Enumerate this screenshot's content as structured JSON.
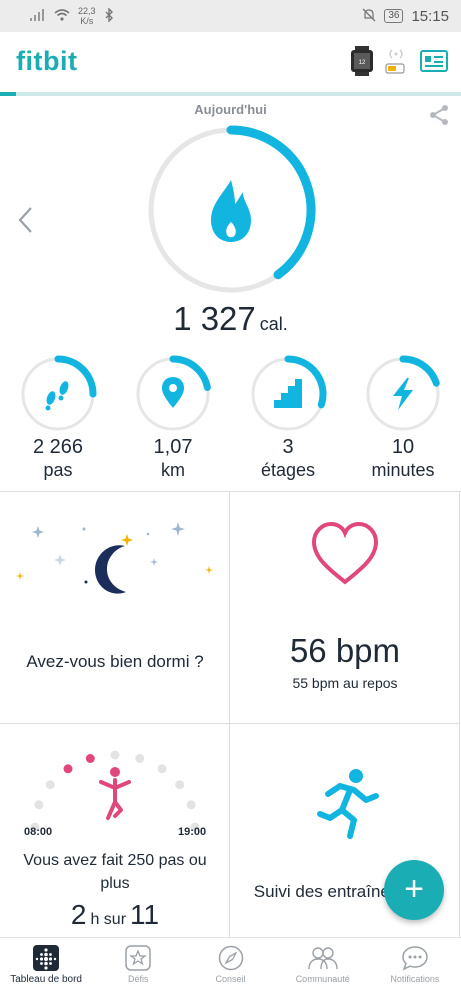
{
  "status_bar": {
    "speed_value": "22,3",
    "speed_unit": "K/s",
    "battery": "36",
    "time": "15:15"
  },
  "header": {
    "logo": "fitbit"
  },
  "summary": {
    "period": "Aujourd'hui",
    "calories_value": "1 327",
    "calories_unit": "cal.",
    "calories_goal_fraction": 0.4
  },
  "stats": [
    {
      "id": "steps",
      "icon": "footsteps-icon",
      "value": "2 266",
      "label": "pas",
      "progress": 0.25
    },
    {
      "id": "distance",
      "icon": "location-pin-icon",
      "value": "1,07",
      "label": "km",
      "progress": 0.22
    },
    {
      "id": "floors",
      "icon": "stairs-icon",
      "value": "3",
      "label": "étages",
      "progress": 0.3
    },
    {
      "id": "active",
      "icon": "lightning-icon",
      "value": "10",
      "label": "minutes",
      "progress": 0.2
    }
  ],
  "tiles": {
    "sleep": {
      "text": "Avez-vous bien dormi ?"
    },
    "heart": {
      "value": "56 bpm",
      "subtext": "55 bpm au repos"
    },
    "hourly": {
      "text": "Vous avez fait 250 pas ou plus",
      "hours_done": "2",
      "hours_sep": "h sur",
      "hours_total": "11",
      "start_time": "08:00",
      "end_time": "19:00"
    },
    "exercise": {
      "text": "Suivi des entraînements"
    }
  },
  "fab": {
    "label": "+"
  },
  "bottom_nav": [
    {
      "label": "Tableau de bord",
      "icon": "dashboard-icon",
      "active": true
    },
    {
      "label": "Défis",
      "icon": "star-badge-icon",
      "active": false
    },
    {
      "label": "Conseil",
      "icon": "compass-icon",
      "active": false
    },
    {
      "label": "Communauté",
      "icon": "community-icon",
      "active": false
    },
    {
      "label": "Notifications",
      "icon": "chat-bubble-icon",
      "active": false
    }
  ],
  "colors": {
    "brand": "#1aaeb4",
    "ring": "#12b5e0",
    "heart": "#e2477a",
    "moon": "#1b2d5b"
  }
}
